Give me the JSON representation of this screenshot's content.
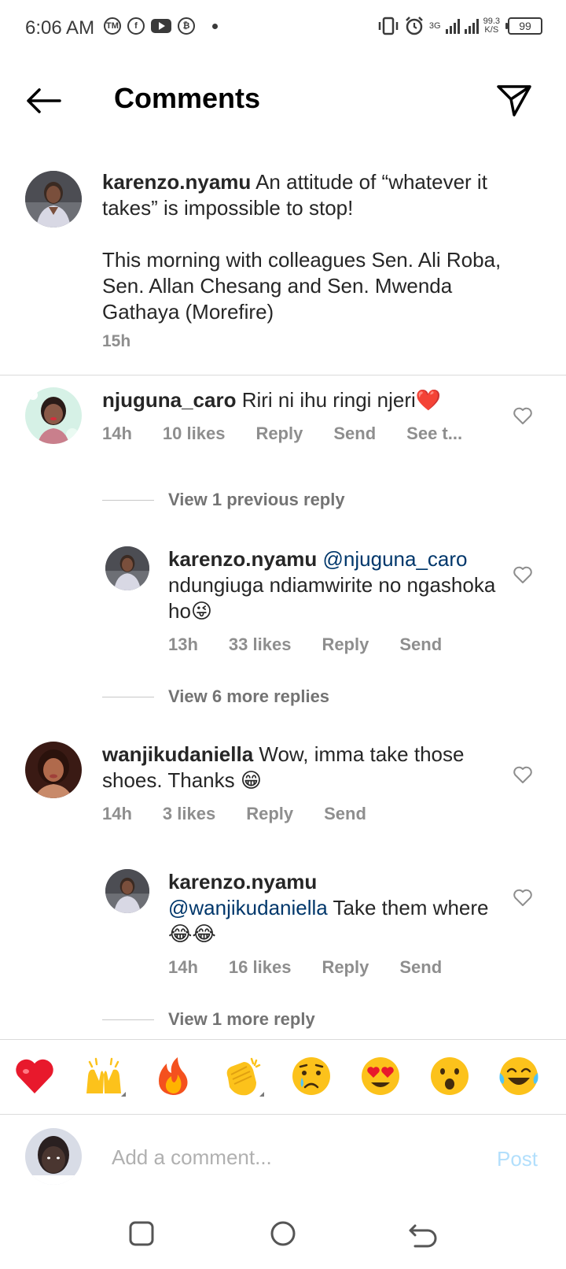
{
  "status_bar": {
    "time": "6:06 AM",
    "app_icons": [
      "tm-icon",
      "facebook-icon",
      "youtube-icon",
      "bitcoin-icon"
    ],
    "network": "3G",
    "speed_value": "99.3",
    "speed_unit": "K/S",
    "battery": "99"
  },
  "header": {
    "title": "Comments",
    "back_icon": "arrow-left-icon",
    "send_icon": "paper-plane-icon"
  },
  "caption": {
    "username": "karenzo.nyamu",
    "text_line1": "An attitude of “whatever it takes” is impossible to stop!",
    "text_line2": "This morning with colleagues Sen. Ali Roba, Sen. Allan Chesang and Sen. Mwenda Gathaya (Morefire)",
    "time": "15h"
  },
  "comments": [
    {
      "username": "njuguna_caro",
      "text": "Riri ni ihu ringi njeri",
      "emoji": "❤️",
      "time": "14h",
      "likes": "10 likes",
      "reply": "Reply",
      "send": "Send",
      "see_translation": "See t..."
    },
    {
      "view_previous": "View 1 previous reply"
    },
    {
      "username": "karenzo.nyamu",
      "mention": "@njuguna_caro",
      "text": "ndungiuga ndiamwirite no ngashoka ho",
      "emoji": "😜",
      "time": "13h",
      "likes": "33 likes",
      "reply": "Reply",
      "send": "Send"
    },
    {
      "view_more": "View 6 more replies"
    },
    {
      "username": "wanjikudaniella",
      "text": "Wow, imma take those shoes. Thanks",
      "emoji": "😁",
      "time": "14h",
      "likes": "3 likes",
      "reply": "Reply",
      "send": "Send"
    },
    {
      "username": "karenzo.nyamu",
      "mention": "@wanjikudaniella",
      "text": "Take them where",
      "emoji": "😂😂",
      "time": "14h",
      "likes": "16 likes",
      "reply": "Reply",
      "send": "Send"
    },
    {
      "view_more": "View 1 more reply"
    }
  ],
  "emoji_bar": [
    "❤️",
    "🙌",
    "🔥",
    "👏",
    "😢",
    "😍",
    "😮",
    "😂"
  ],
  "composer": {
    "placeholder": "Add a comment...",
    "post_label": "Post"
  },
  "navbar": {
    "icons": [
      "recent-apps-icon",
      "home-icon",
      "back-icon"
    ]
  },
  "colors": {
    "text": "#262626",
    "secondary": "#8e8e8e",
    "mention": "#00376b",
    "post_disabled": "#b2dffc",
    "heart_red": "#ed1c24"
  }
}
